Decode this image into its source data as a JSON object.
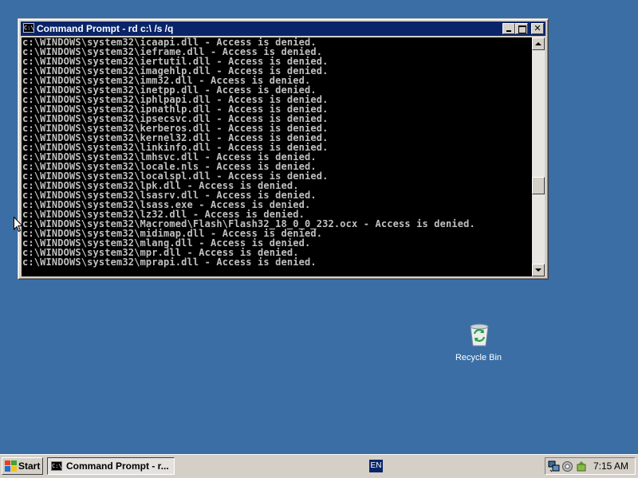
{
  "colors": {
    "desktop": "#3A6EA5",
    "titlebar_active": "#0A246A",
    "console_bg": "#000000",
    "console_text": "#C0C0C0",
    "chrome": "#D4D0C8"
  },
  "window": {
    "title": "Command Prompt - rd c:\\ /s /q",
    "icon_glyph": "C:\\",
    "icon": "console-icon",
    "controls": {
      "minimize": "minimize-icon",
      "maximize": "maximize-icon",
      "close_glyph": "✕"
    }
  },
  "console": {
    "lines": [
      "c:\\WINDOWS\\system32\\icaapi.dll - Access is denied.",
      "c:\\WINDOWS\\system32\\ieframe.dll - Access is denied.",
      "c:\\WINDOWS\\system32\\iertutil.dll - Access is denied.",
      "c:\\WINDOWS\\system32\\imagehlp.dll - Access is denied.",
      "c:\\WINDOWS\\system32\\imm32.dll - Access is denied.",
      "c:\\WINDOWS\\system32\\inetpp.dll - Access is denied.",
      "c:\\WINDOWS\\system32\\iphlpapi.dll - Access is denied.",
      "c:\\WINDOWS\\system32\\ipnathlp.dll - Access is denied.",
      "c:\\WINDOWS\\system32\\ipsecsvc.dll - Access is denied.",
      "c:\\WINDOWS\\system32\\kerberos.dll - Access is denied.",
      "c:\\WINDOWS\\system32\\kernel32.dll - Access is denied.",
      "c:\\WINDOWS\\system32\\linkinfo.dll - Access is denied.",
      "c:\\WINDOWS\\system32\\lmhsvc.dll - Access is denied.",
      "c:\\WINDOWS\\system32\\locale.nls - Access is denied.",
      "c:\\WINDOWS\\system32\\localspl.dll - Access is denied.",
      "c:\\WINDOWS\\system32\\lpk.dll - Access is denied.",
      "c:\\WINDOWS\\system32\\lsasrv.dll - Access is denied.",
      "c:\\WINDOWS\\system32\\lsass.exe - Access is denied.",
      "c:\\WINDOWS\\system32\\lz32.dll - Access is denied.",
      "c:\\WINDOWS\\system32\\Macromed\\Flash\\Flash32_18_0_0_232.ocx - Access is denied.",
      "c:\\WINDOWS\\system32\\midimap.dll - Access is denied.",
      "c:\\WINDOWS\\system32\\mlang.dll - Access is denied.",
      "c:\\WINDOWS\\system32\\mpr.dll - Access is denied.",
      "c:\\WINDOWS\\system32\\mprapi.dll - Access is denied."
    ]
  },
  "desktop_icons": [
    {
      "label": "Recycle Bin",
      "icon": "recycle-bin-icon"
    }
  ],
  "taskbar": {
    "start_label": "Start",
    "start_icon": "windows-logo-icon",
    "tasks": [
      {
        "label": "Command Prompt - r...",
        "icon": "console-icon",
        "icon_glyph": "C:\\",
        "active": true
      }
    ],
    "language": "EN",
    "tray_icons": [
      "network-icon",
      "audio-icon",
      "update-icon"
    ],
    "clock": "7:15 AM"
  }
}
